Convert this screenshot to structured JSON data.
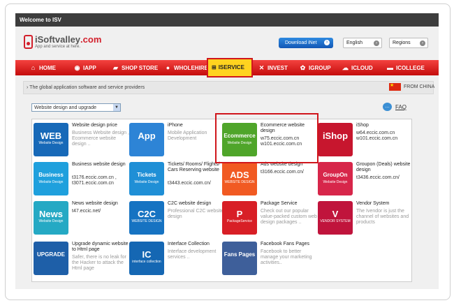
{
  "window": {
    "title": "Welcome to ISV"
  },
  "header": {
    "logo_name": "iSoftvalley",
    "logo_suffix": ".com",
    "logo_tagline": "App and service at here.",
    "download_label": "Download iNet",
    "language": "English",
    "region": "Regions"
  },
  "nav": {
    "items": [
      {
        "label": "HOME",
        "icon": "home-icon"
      },
      {
        "label": "IAPP",
        "icon": "app-icon"
      },
      {
        "label": "SHOP STORE",
        "icon": "cart-icon"
      },
      {
        "label": "WHOLEHIRE",
        "icon": "person-icon"
      },
      {
        "label": "ISERVICE",
        "icon": "grid-icon"
      },
      {
        "label": "INVEST",
        "icon": "tools-icon"
      },
      {
        "label": "IGROUP",
        "icon": "group-icon"
      },
      {
        "label": "ICLOUD",
        "icon": "cloud-icon"
      },
      {
        "label": "ICOLLEGE",
        "icon": "college-icon"
      }
    ],
    "active": "ISERVICE",
    "bar_color": "#d81414",
    "active_color": "#ffd31f"
  },
  "strip": {
    "tagline": "The global application software and service providers",
    "country_label": "FROM CHINA"
  },
  "filter": {
    "selected": "Website design and upgrade"
  },
  "faq_label": "FAQ",
  "services": [
    {
      "tile_big": "WEB",
      "tile_small": "Website Design",
      "title": "Website design price",
      "desc": "Business Website design , Ecommerce website design ..",
      "color": "#1769b8"
    },
    {
      "tile_big": "App",
      "tile_small": "",
      "title": "iPhone",
      "desc": "Mobile Application Development",
      "color": "#2d84d6"
    },
    {
      "tile_big": "Ecommerce",
      "tile_small": "Website Design",
      "title": "Ecommerce website design",
      "desc": "w75.eccic.com.cn\nw101.eccic.com.cn",
      "color": "#4fa52a"
    },
    {
      "tile_big": "iShop",
      "tile_small": "",
      "title": "iShop",
      "desc": "w64.eccic.com.cn\nw101.eccic.com.cn",
      "color": "#c7162e"
    },
    {
      "tile_big": "Business",
      "tile_small": "Website Design",
      "title": "Business website design",
      "desc": "t3176.eccic.com.cn , t3071.eccic.com.cn",
      "color": "#1fa0dd"
    },
    {
      "tile_big": "Tickets",
      "tile_small": "Website Design",
      "title": "Tickets/ Rooms/ Flights/ Cars Reserving website",
      "desc": "t3443.eccic.com.cn/",
      "color": "#1f8fd6"
    },
    {
      "tile_big": "ADS",
      "tile_small": "WEBSITE DESIGN",
      "title": "Ads website design",
      "desc": "t3166.eccic.com.cn/",
      "color": "#f15a22"
    },
    {
      "tile_big": "GroupOn",
      "tile_small": "Website Design",
      "title": "Groupon (Deals) website design",
      "desc": "t3436.eccic.com.cn/",
      "color": "#d7264a"
    },
    {
      "tile_big": "News",
      "tile_small": "Website Design",
      "title": "News website design",
      "desc": "t47.eccic.net/",
      "color": "#25a9c4"
    },
    {
      "tile_big": "C2C",
      "tile_small": "WEBSITE DESIGN",
      "title": "C2C website design",
      "desc": "Professional C2C website design",
      "color": "#1673c2"
    },
    {
      "tile_big": "P",
      "tile_small": "PackageService",
      "title": "Package Service",
      "desc": "Check out our popular value-packed custom web design packages ..",
      "color": "#d81f26"
    },
    {
      "tile_big": "V",
      "tile_small": "VENDOR SYSTEM",
      "title": "Vendor System",
      "desc": "The Ivendor is just the channel of websites and products",
      "color": "#c0143c"
    },
    {
      "tile_big": "UPGRADE",
      "tile_small": "",
      "title": "Upgrade dynamic website to Html page",
      "desc": "Safer, there is no leak for the Hacker to attack the Html page",
      "color": "#1e5fa8"
    },
    {
      "tile_big": "IC",
      "tile_small": "interface collection",
      "title": "Interface Collection",
      "desc": "Interface development services ..",
      "color": "#1567b3"
    },
    {
      "tile_big": "Fans Pages",
      "tile_small": "",
      "title": "Facebook Fans Pages",
      "desc": "Facebook to better manage your marketing activities..",
      "color": "#3e5f9a"
    }
  ]
}
